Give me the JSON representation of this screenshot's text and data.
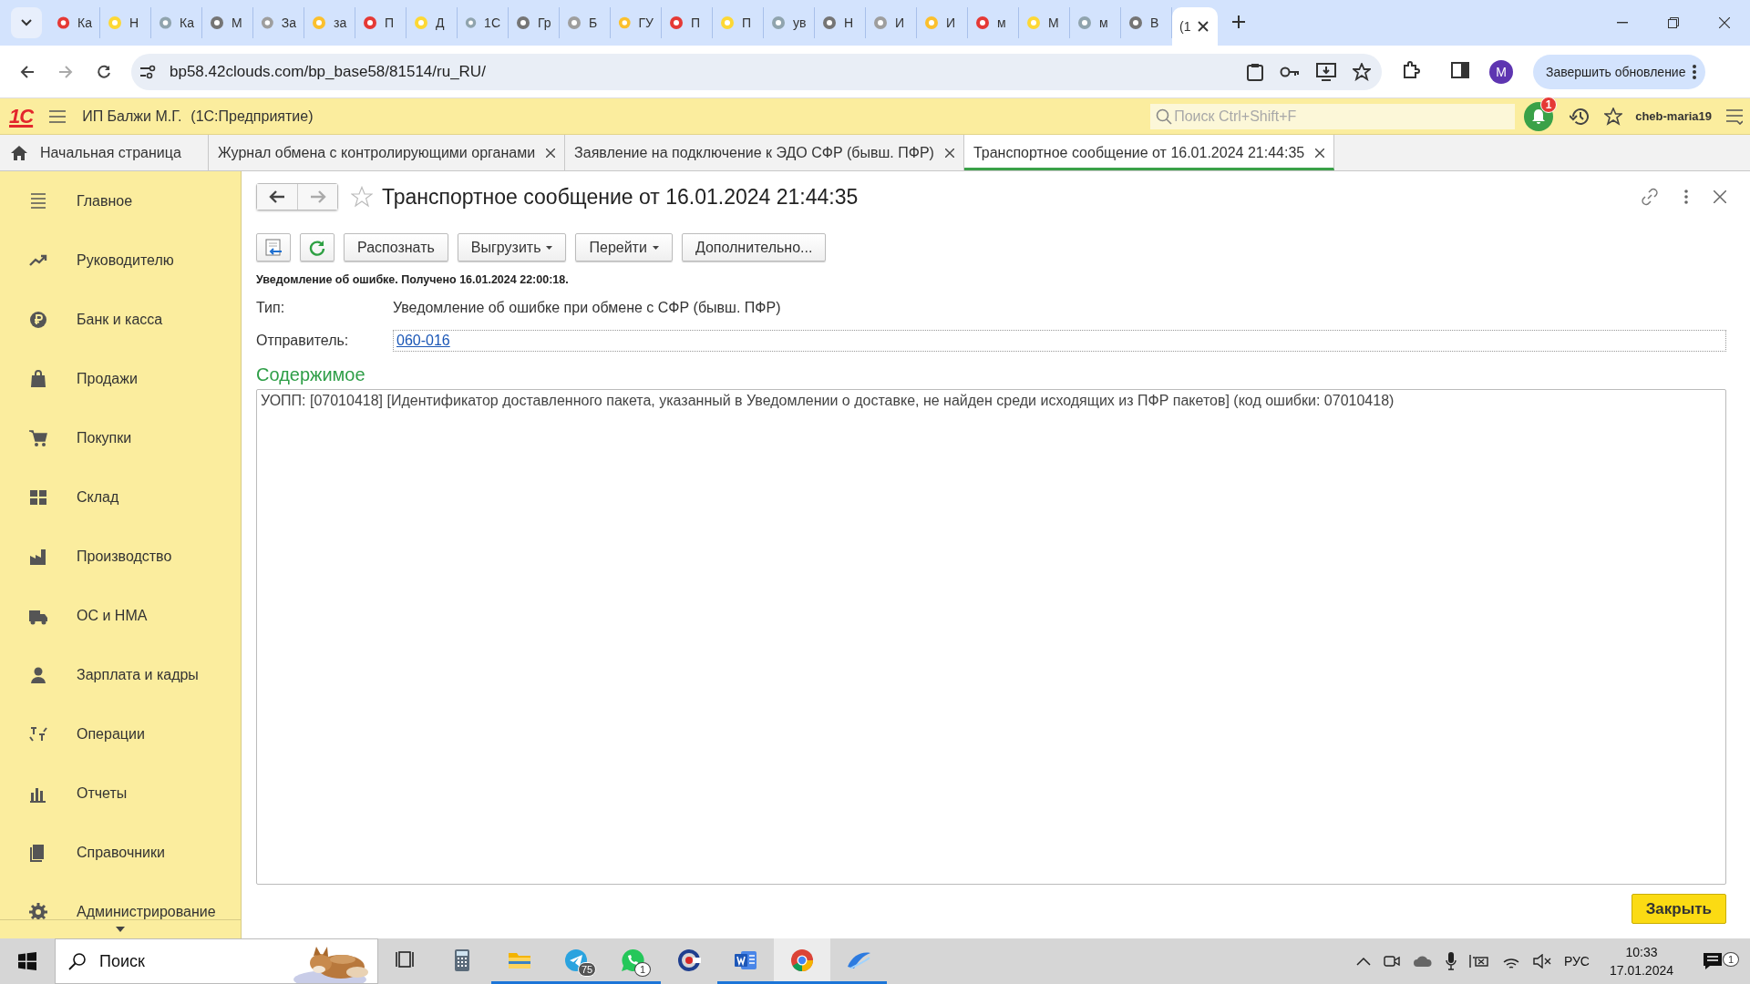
{
  "browser": {
    "tabs": [
      {
        "label": "Ка",
        "selected": false
      },
      {
        "label": "Н",
        "selected": false
      },
      {
        "label": "Ка",
        "selected": false
      },
      {
        "label": "М",
        "selected": false
      },
      {
        "label": "За",
        "selected": false
      },
      {
        "label": "за",
        "selected": false
      },
      {
        "label": "П",
        "selected": false
      },
      {
        "label": "Д",
        "selected": false
      },
      {
        "label": "1С",
        "selected": false
      },
      {
        "label": "Гр",
        "selected": false
      },
      {
        "label": "Б",
        "selected": false
      },
      {
        "label": "ГУ",
        "selected": false
      },
      {
        "label": "П",
        "selected": false
      },
      {
        "label": "П",
        "selected": false
      },
      {
        "label": "ув",
        "selected": false
      },
      {
        "label": "Н",
        "selected": false
      },
      {
        "label": "И",
        "selected": false
      },
      {
        "label": "И",
        "selected": false
      },
      {
        "label": "м",
        "selected": false
      },
      {
        "label": "М",
        "selected": false
      },
      {
        "label": "м",
        "selected": false
      },
      {
        "label": "В",
        "selected": false
      },
      {
        "label": "(1",
        "selected": true
      }
    ],
    "url": "bp58.42clouds.com/bp_base58/81514/ru_RU/",
    "avatar": "M",
    "update_button": "Завершить обновление"
  },
  "app": {
    "logo": "1С",
    "company": "ИП Балжи М.Г.",
    "platform": "(1С:Предприятие)",
    "search": {
      "placeholder": "Поиск Ctrl+Shift+F"
    },
    "notification_count": "1",
    "user": "cheb-maria19"
  },
  "app_tabs": [
    {
      "label": "Начальная страница",
      "kind": "home",
      "selected": false
    },
    {
      "label": "Журнал обмена с контролирующими органами",
      "kind": "document",
      "selected": false
    },
    {
      "label": "Заявление на подключение к ЭДО СФР (бывш. ПФР)",
      "kind": "document",
      "selected": false
    },
    {
      "label": "Транспортное сообщение от 16.01.2024 21:44:35",
      "kind": "document",
      "selected": true
    }
  ],
  "sidebar": {
    "items": [
      {
        "label": "Главное"
      },
      {
        "label": "Руководителю"
      },
      {
        "label": "Банк и касса"
      },
      {
        "label": "Продажи"
      },
      {
        "label": "Покупки"
      },
      {
        "label": "Склад"
      },
      {
        "label": "Производство"
      },
      {
        "label": "ОС и НМА"
      },
      {
        "label": "Зарплата и кадры"
      },
      {
        "label": "Операции"
      },
      {
        "label": "Отчеты"
      },
      {
        "label": "Справочники"
      },
      {
        "label": "Администрирование"
      }
    ]
  },
  "document": {
    "title": "Транспортное сообщение от 16.01.2024 21:44:35",
    "favorite": false,
    "toolbar": [
      {
        "label": "Распознать",
        "dropdown": false
      },
      {
        "label": "Выгрузить",
        "dropdown": true
      },
      {
        "label": "Перейти",
        "dropdown": true
      },
      {
        "label": "Дополнительно...",
        "dropdown": false
      }
    ],
    "status": "Уведомление об ошибке. Получено 16.01.2024 22:00:18.",
    "fields": [
      {
        "label": "Тип:",
        "value": "Уведомление об ошибке при обмене с СФР (бывш. ПФР)",
        "kind": "text"
      },
      {
        "label": "Отправитель:",
        "value": "060-016",
        "kind": "link"
      }
    ],
    "section_title": "Содержимое",
    "content": "УОПП: [07010418] [Идентификатор доставленного пакета, указанный в Уведомлении о доставке, не найден среди исходящих из ПФР пакетов] (код ошибки: 07010418)",
    "close_button": "Закрыть"
  },
  "taskbar": {
    "search": {
      "placeholder": "Поиск"
    },
    "apps": [
      {
        "kind": "taskview",
        "running": false,
        "selected": false
      },
      {
        "kind": "calculator",
        "running": false,
        "selected": false
      },
      {
        "kind": "folder",
        "running": true,
        "selected": false
      },
      {
        "kind": "telegram",
        "running": true,
        "selected": false,
        "badge": "75"
      },
      {
        "kind": "whatsapp",
        "running": true,
        "selected": false,
        "badge": "1"
      },
      {
        "kind": "circle",
        "running": false,
        "selected": false
      },
      {
        "kind": "word",
        "running": true,
        "selected": false
      },
      {
        "kind": "chrome",
        "running": true,
        "selected": true
      },
      {
        "kind": "wave",
        "running": true,
        "selected": false
      }
    ],
    "language": "РУС",
    "time": "10:33",
    "date": "17.01.2024",
    "notifications": "1"
  }
}
